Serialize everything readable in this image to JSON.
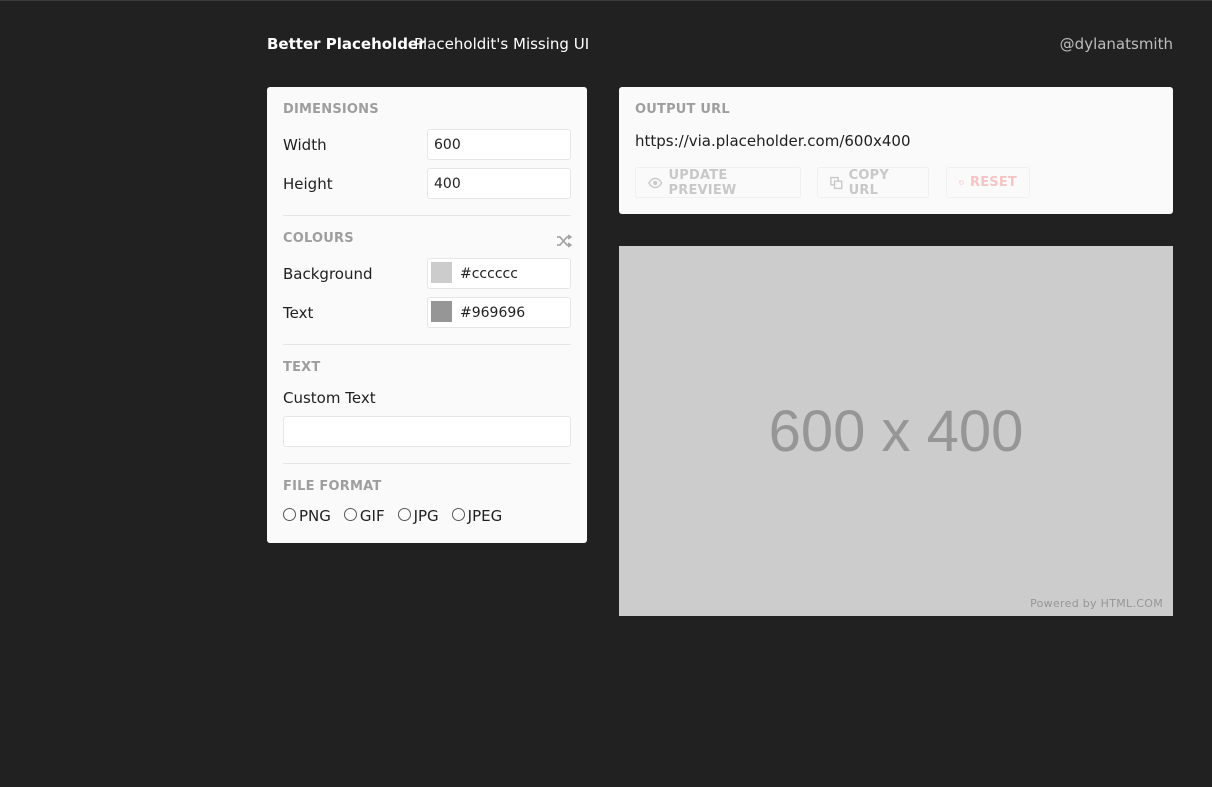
{
  "header": {
    "brand": "Better Placeholder",
    "tagline": "Placeholdit's Missing UI",
    "handle": "@dylanatsmith"
  },
  "dimensions": {
    "title": "DIMENSIONS",
    "width_label": "Width",
    "width_value": "600",
    "height_label": "Height",
    "height_value": "400"
  },
  "colours": {
    "title": "COLOURS",
    "shuffle_icon": "shuffle-icon",
    "background_label": "Background",
    "background_value": "#cccccc",
    "text_label": "Text",
    "text_value": "#969696"
  },
  "text_section": {
    "title": "TEXT",
    "custom_label": "Custom Text",
    "custom_value": ""
  },
  "file_format": {
    "title": "FILE FORMAT",
    "options": [
      "PNG",
      "GIF",
      "JPG",
      "JPEG"
    ],
    "selected": null
  },
  "output": {
    "title": "OUTPUT URL",
    "url": "https://via.placeholder.com/600x400",
    "update_label": "UPDATE PREVIEW",
    "copy_label": "COPY URL",
    "reset_label": "RESET"
  },
  "preview": {
    "text": "600 x 400",
    "powered": "Powered by HTML.COM",
    "background": "#cccccc",
    "text_color": "#969696"
  },
  "colors": {
    "page_bg": "#212121",
    "panel_bg": "#fafafa",
    "muted": "#9e9e9e",
    "reset_accent": "#f3c6c6"
  }
}
